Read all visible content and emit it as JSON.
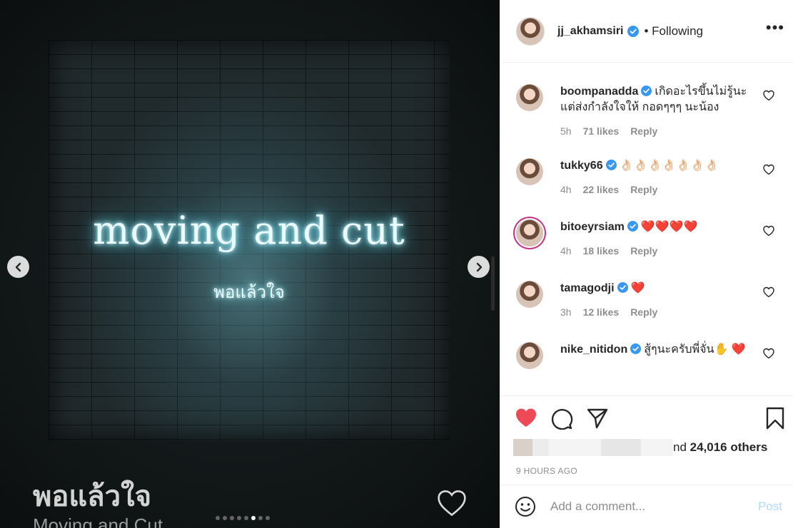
{
  "media": {
    "neon_title": "moving and cut",
    "neon_subtitle": "พอแล้วใจ",
    "video_title": "พอแล้วใจ",
    "video_artist": "Moving and Cut",
    "carousel": {
      "total": 8,
      "active_index": 5
    },
    "prev_icon": "chevron-left-icon",
    "next_icon": "chevron-right-icon"
  },
  "header": {
    "username": "jj_akhamsiri",
    "follow_status": "• Following",
    "more_icon": "•••"
  },
  "comments": [
    {
      "username": "boompanadda",
      "text": "เกิดอะไรขึ้นไม่รู้นะ แต่ส่งกำลังใจให้ กอดๆๆๆ นะน้อง",
      "time": "5h",
      "likes": "71 likes",
      "reply": "Reply",
      "ring": false
    },
    {
      "username": "tukky66",
      "text": "👌🏻👌🏻👌🏻👌🏻👌🏻👌🏻👌🏻",
      "time": "4h",
      "likes": "22 likes",
      "reply": "Reply",
      "ring": false
    },
    {
      "username": "bitoeyrsiam",
      "text": "❤️❤️❤️❤️",
      "time": "4h",
      "likes": "18 likes",
      "reply": "Reply",
      "ring": true
    },
    {
      "username": "tamagodji",
      "text": "❤️",
      "time": "3h",
      "likes": "12 likes",
      "reply": "Reply",
      "ring": false
    },
    {
      "username": "nike_nitidon",
      "text": "สู้ๆนะครับพี่จั่น✋ ❤️",
      "time": "",
      "likes": "",
      "reply": "",
      "ring": false
    }
  ],
  "actions": {
    "likes_suffix": "nd ",
    "likes_count": "24,016 others",
    "timestamp": "9 HOURS AGO"
  },
  "composer": {
    "placeholder": "Add a comment...",
    "post_label": "Post"
  },
  "colors": {
    "like_red": "#ed4956",
    "verified_blue": "#3897f0",
    "post_disabled": "#b3dbff",
    "story_ring": "#c13584"
  }
}
